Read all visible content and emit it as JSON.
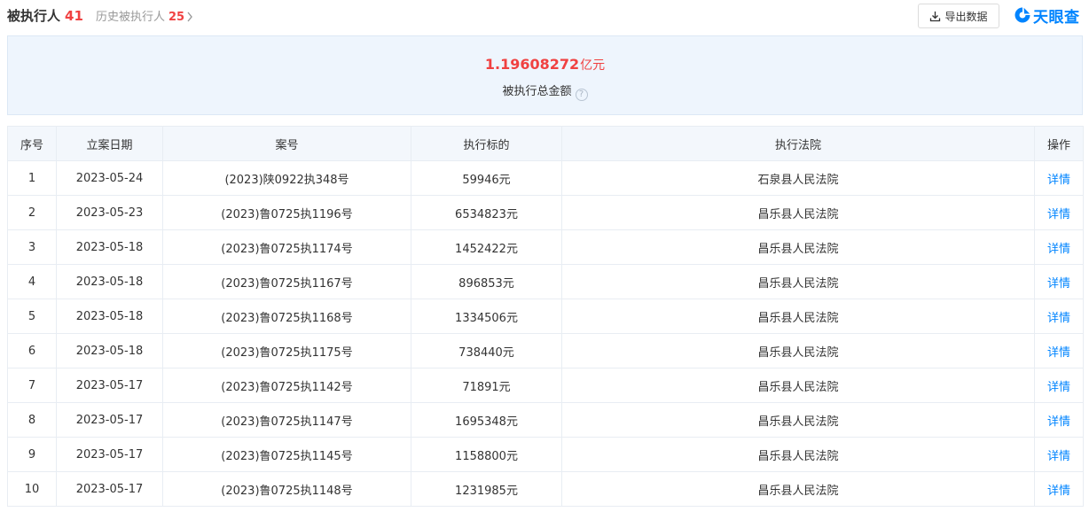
{
  "header": {
    "current_tab": {
      "label": "被执行人",
      "count": "41"
    },
    "history_tab": {
      "label": "历史被执行人",
      "count": "25"
    },
    "export_label": "导出数据",
    "brand": "天眼查"
  },
  "summary": {
    "amount": "1.19608272",
    "unit": "亿元",
    "label": "被执行总金额",
    "help_symbol": "?"
  },
  "table": {
    "columns": [
      "序号",
      "立案日期",
      "案号",
      "执行标的",
      "执行法院",
      "操作"
    ],
    "rows": [
      {
        "no": "1",
        "date": "2023-05-24",
        "case": "(2023)陕0922执348号",
        "amount": "59946元",
        "court": "石泉县人民法院",
        "action": "详情"
      },
      {
        "no": "2",
        "date": "2023-05-23",
        "case": "(2023)鲁0725执1196号",
        "amount": "6534823元",
        "court": "昌乐县人民法院",
        "action": "详情"
      },
      {
        "no": "3",
        "date": "2023-05-18",
        "case": "(2023)鲁0725执1174号",
        "amount": "1452422元",
        "court": "昌乐县人民法院",
        "action": "详情"
      },
      {
        "no": "4",
        "date": "2023-05-18",
        "case": "(2023)鲁0725执1167号",
        "amount": "896853元",
        "court": "昌乐县人民法院",
        "action": "详情"
      },
      {
        "no": "5",
        "date": "2023-05-18",
        "case": "(2023)鲁0725执1168号",
        "amount": "1334506元",
        "court": "昌乐县人民法院",
        "action": "详情"
      },
      {
        "no": "6",
        "date": "2023-05-18",
        "case": "(2023)鲁0725执1175号",
        "amount": "738440元",
        "court": "昌乐县人民法院",
        "action": "详情"
      },
      {
        "no": "7",
        "date": "2023-05-17",
        "case": "(2023)鲁0725执1142号",
        "amount": "71891元",
        "court": "昌乐县人民法院",
        "action": "详情"
      },
      {
        "no": "8",
        "date": "2023-05-17",
        "case": "(2023)鲁0725执1147号",
        "amount": "1695348元",
        "court": "昌乐县人民法院",
        "action": "详情"
      },
      {
        "no": "9",
        "date": "2023-05-17",
        "case": "(2023)鲁0725执1145号",
        "amount": "1158800元",
        "court": "昌乐县人民法院",
        "action": "详情"
      },
      {
        "no": "10",
        "date": "2023-05-17",
        "case": "(2023)鲁0725执1148号",
        "amount": "1231985元",
        "court": "昌乐县人民法院",
        "action": "详情"
      }
    ]
  },
  "icons": {
    "export": "download-icon",
    "history_arrow": "chevron-right-icon",
    "help": "help-circle-icon",
    "brand": "tianyancha-logo-icon"
  },
  "colors": {
    "accent": "#0084ff",
    "highlight": "#f04141",
    "summary_bg": "#eef5fd",
    "header_bg": "#f3f7fc"
  }
}
